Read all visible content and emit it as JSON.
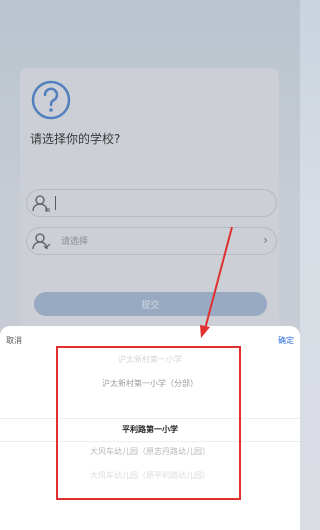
{
  "form": {
    "question": "请选择你的学校?",
    "name_value": "",
    "school_placeholder": "请选择",
    "submit_label": "提交"
  },
  "picker": {
    "cancel_label": "取消",
    "confirm_label": "确定",
    "options": [
      "沪太新村第一小学",
      "沪太新村第一小学（分部）",
      "平利路第一小学",
      "大风车幼儿园（原志丹路幼儿园）",
      "大风车幼儿园（原平利路幼儿园）"
    ],
    "selected_index": 2
  },
  "colors": {
    "accent": "#2f6fdb",
    "highlight": "#e03030"
  }
}
